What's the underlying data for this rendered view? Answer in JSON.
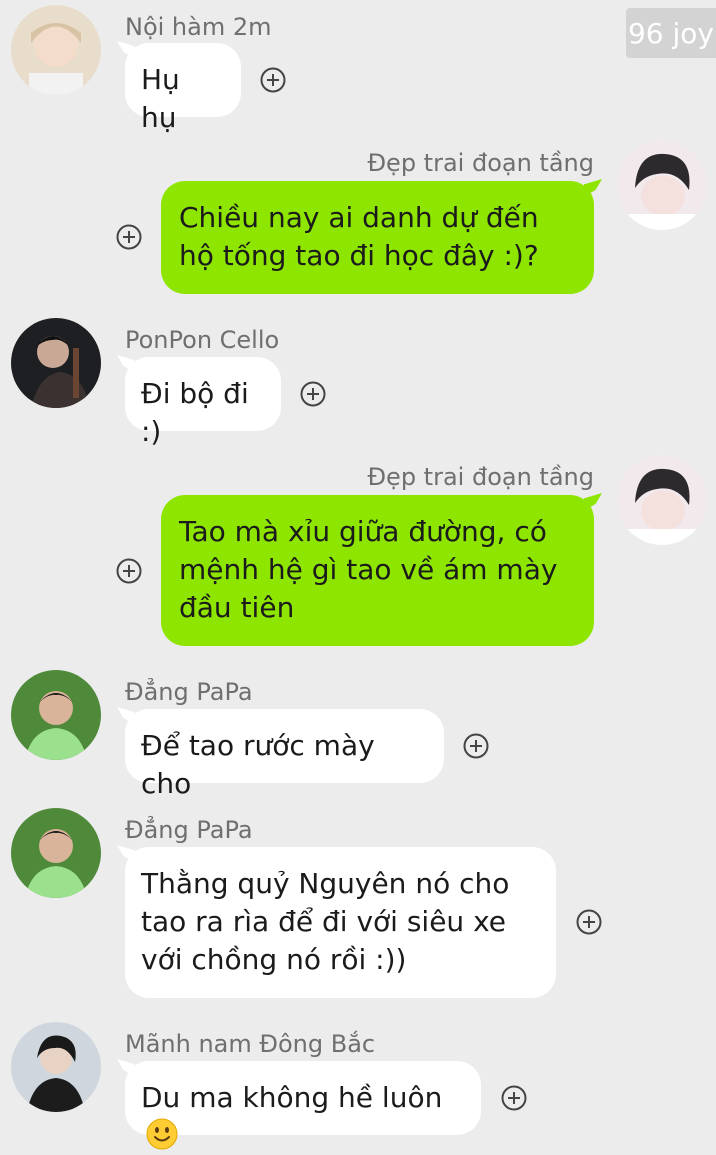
{
  "watermark": "96 joy",
  "messages": [
    {
      "sender": "Nội hàm 2m",
      "text": "Hụ hụ",
      "side": "left",
      "avatar_icon": "avatar-icon"
    },
    {
      "sender": "Đẹp trai đoạn tầng",
      "text": "Chiều nay ai danh dự đến hộ tống tao đi học đây :)?",
      "side": "right",
      "avatar_icon": "avatar-icon"
    },
    {
      "sender": "PonPon Cello",
      "text": "Đi bộ đi :)",
      "side": "left",
      "avatar_icon": "avatar-icon"
    },
    {
      "sender": "Đẹp trai đoạn tầng",
      "text": "Tao mà xỉu giữa đường, có mệnh hệ gì tao về ám mày đầu tiên",
      "side": "right",
      "avatar_icon": "avatar-icon"
    },
    {
      "sender": "Đẳng PaPa",
      "text": "Để tao rước mày cho",
      "side": "left",
      "avatar_icon": "avatar-icon"
    },
    {
      "sender": "Đẳng PaPa",
      "text": "Thằng quỷ Nguyên nó cho tao ra rìa để đi với siêu xe với chồng nó rồi :))",
      "side": "left",
      "avatar_icon": "avatar-icon"
    },
    {
      "sender": "Mãnh nam Đông Bắc",
      "text": "Du ma không hề luôn",
      "side": "left",
      "avatar_icon": "avatar-icon",
      "emoji": "smiley-emoji-icon"
    }
  ],
  "colors": {
    "background": "#ececec",
    "bubble_left": "#ffffff",
    "bubble_right": "#8ee500",
    "name_text": "#6f6f6f"
  },
  "icons": {
    "add": "plus-circle-icon"
  }
}
